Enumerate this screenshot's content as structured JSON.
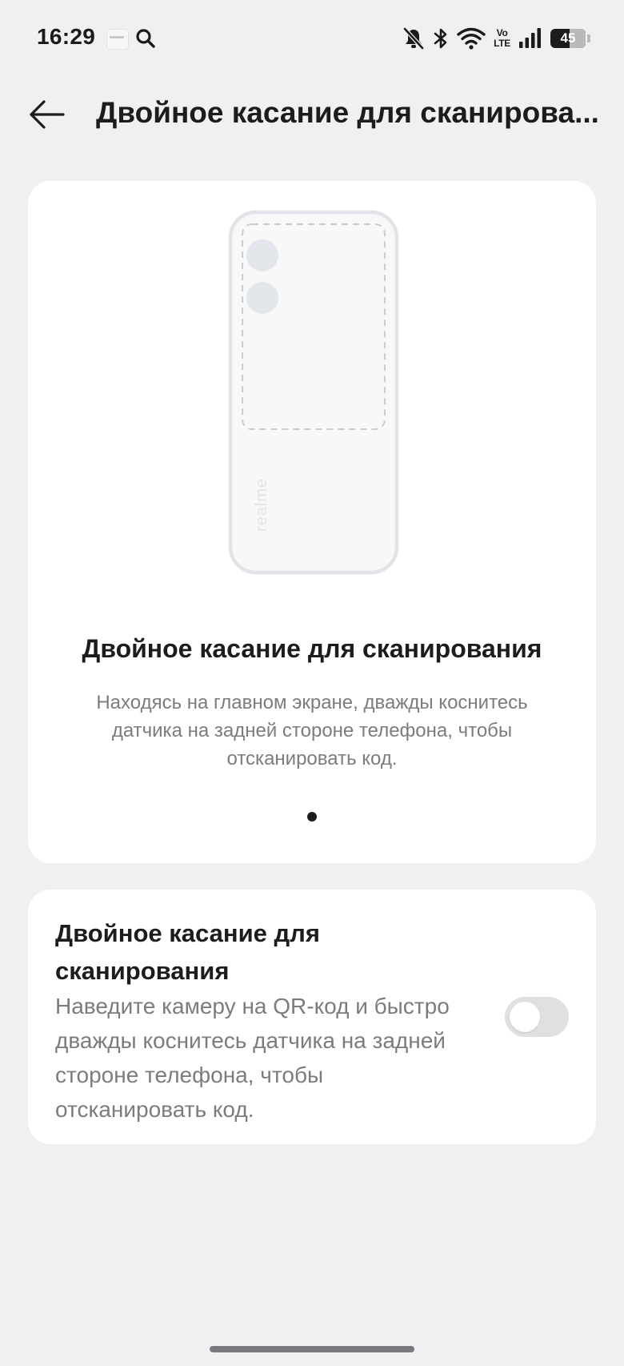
{
  "status_bar": {
    "time": "16:29",
    "network": [
      "Vo",
      "LTE"
    ],
    "battery_level": "45",
    "icons": [
      "app-notification-icon",
      "search-icon",
      "bell-muted-icon",
      "bluetooth-icon",
      "wifi-icon",
      "signal-icon",
      "battery-icon"
    ]
  },
  "header": {
    "back_icon": "arrow-left-icon",
    "title": "Двойное касание для сканирова..."
  },
  "illustration": {
    "brand_text": "realme",
    "title": "Двойное касание для сканирования",
    "description": "Находясь на главном экране, дважды коснитесь датчика на задней стороне телефона, чтобы отсканировать код.",
    "page_indicator": {
      "total": 1,
      "current": 1
    }
  },
  "setting": {
    "title": "Двойное касание для сканирования",
    "description": "Наведите камеру на QR-код и быстро дважды коснитесь датчика на задней стороне телефона, чтобы отсканировать код.",
    "toggle_on": false
  },
  "colors": {
    "background": "#eff0f2",
    "card": "#ffffff",
    "primary_text": "#1c1c1e",
    "secondary_text": "#7c7c80",
    "toggle_off": "#e0e0e2"
  }
}
